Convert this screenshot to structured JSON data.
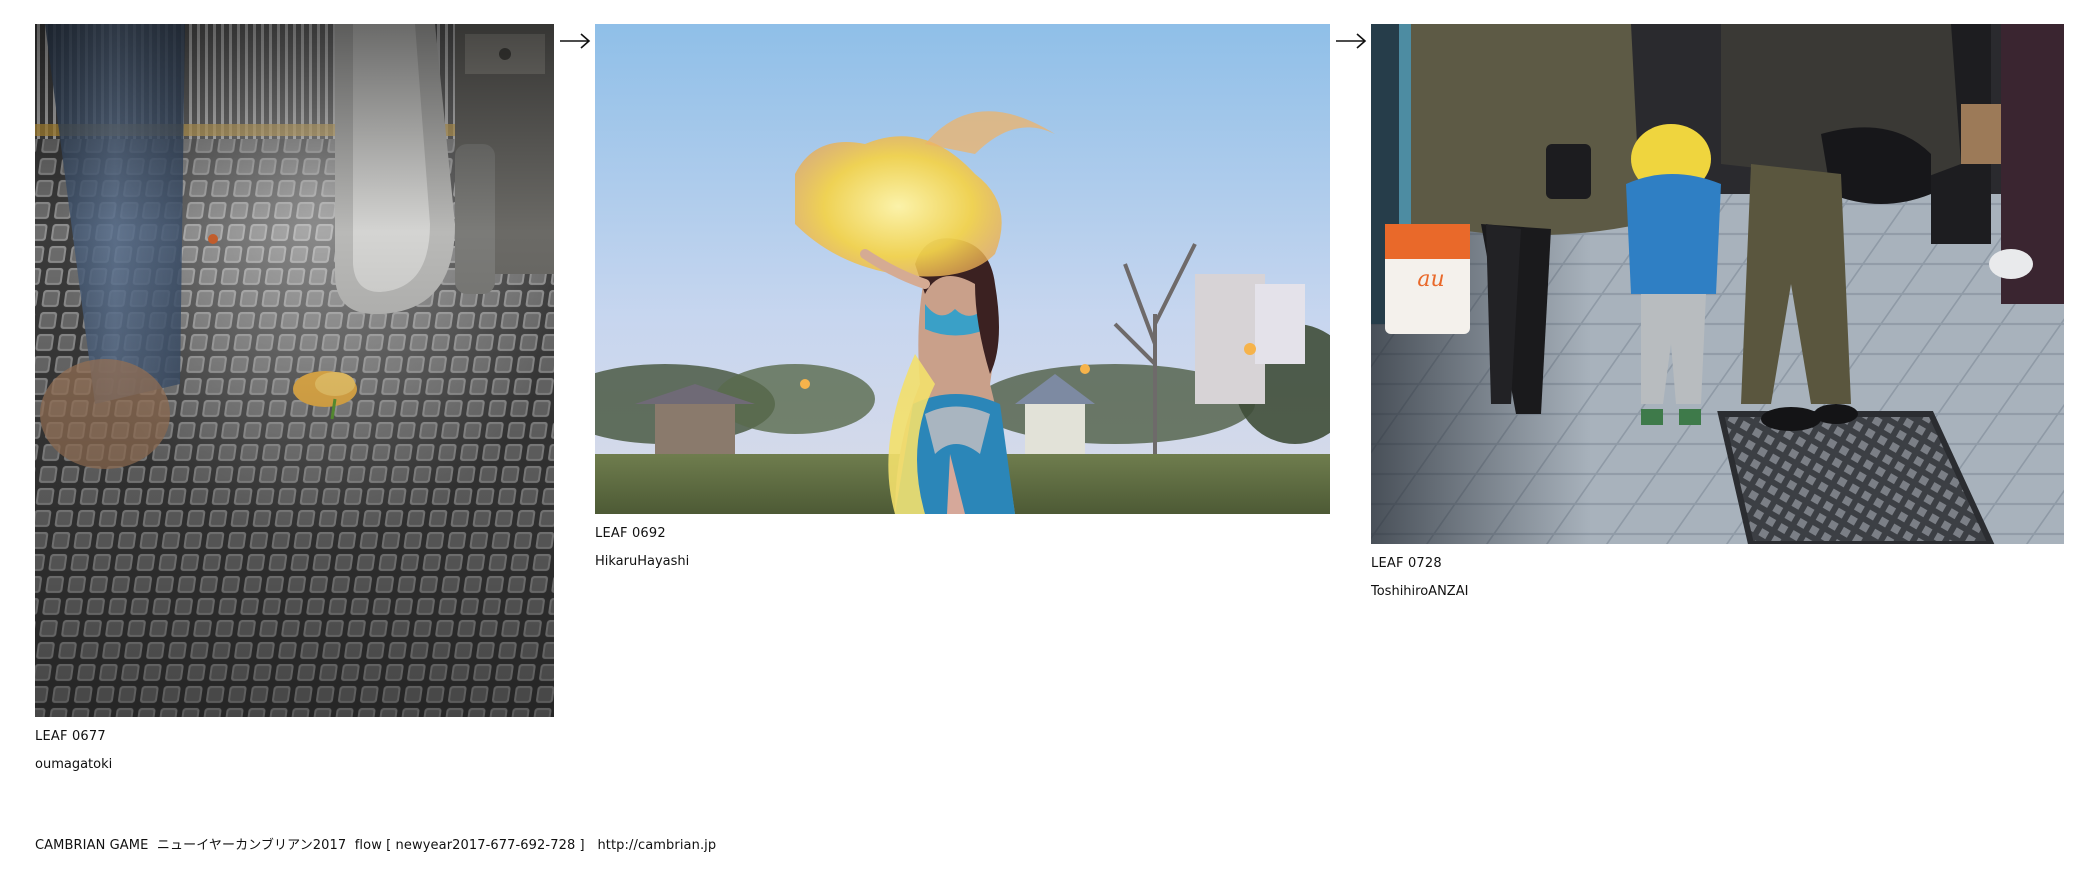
{
  "leaves": [
    {
      "id_label": "LEAF 0677",
      "author": "oumagatoki",
      "image_subject": "escalator step with fallen yellow rose and blurred legs"
    },
    {
      "id_label": "LEAF 0692",
      "author": "HikaruHayashi",
      "image_subject": "belly dancer with yellow silk fan veil in park at dusk"
    },
    {
      "id_label": "LEAF 0728",
      "author": "ToshihiroANZAI",
      "image_subject": "child in yellow hood walking with adults on city sidewalk"
    }
  ],
  "arrows": [
    "arrow-right-icon",
    "arrow-right-icon"
  ],
  "footer": {
    "site": "CAMBRIAN GAME",
    "event": "ニューイヤーカンブリアン2017",
    "flow": "flow [ newyear2017-677-692-728 ]",
    "url": "http://cambrian.jp"
  }
}
